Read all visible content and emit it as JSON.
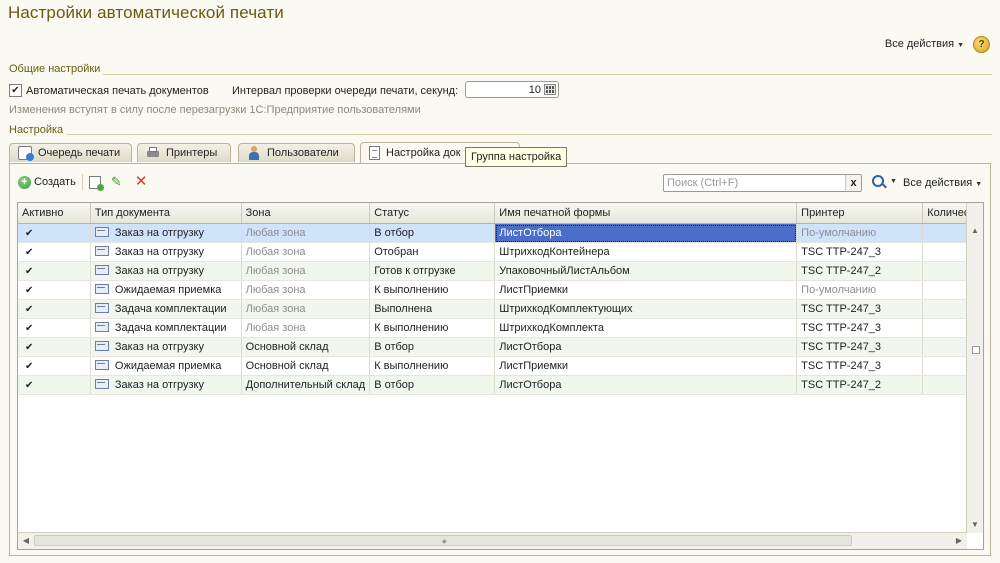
{
  "title": "Настройки автоматической печати",
  "top_actions": {
    "all_actions": "Все действия",
    "help": "?"
  },
  "general": {
    "caption": "Общие настройки",
    "auto_print_label": "Автоматическая печать документов",
    "auto_print_checked": true,
    "interval_label": "Интервал проверки очереди печати, секунд:",
    "interval_value": "10",
    "note": "Изменения вступят в силу после перезагрузки 1С:Предприятие пользователями"
  },
  "settings": {
    "caption": "Настройка",
    "tabs": [
      {
        "label": "Очередь печати",
        "icon": "print-queue-icon"
      },
      {
        "label": "Принтеры",
        "icon": "printer-icon"
      },
      {
        "label": "Пользователи",
        "icon": "user-icon"
      },
      {
        "label": "Настройка док",
        "icon": "document-icon",
        "active": true
      }
    ],
    "tooltip": "Группа настройка"
  },
  "toolbar": {
    "create_label": "Создать",
    "search_placeholder": "Поиск (Ctrl+F)",
    "clear_label": "x",
    "all_actions": "Все действия"
  },
  "table": {
    "columns": [
      "Активно",
      "Тип документа",
      "Зона",
      "Статус",
      "Имя печатной формы",
      "Принтер",
      "Количес"
    ],
    "rows": [
      {
        "active": "✔",
        "doc_type": "Заказ на отгрузку",
        "zone": "Любая зона",
        "status": "В отбор",
        "form": "ЛистОтбора",
        "printer": "По-умолчанию"
      },
      {
        "active": "✔",
        "doc_type": "Заказ на отгрузку",
        "zone": "Любая зона",
        "status": "Отобран",
        "form": "ШтрихкодКонтейнера",
        "printer": "TSC TTP-247_3"
      },
      {
        "active": "✔",
        "doc_type": "Заказ на отгрузку",
        "zone": "Любая зона",
        "status": "Готов к отгрузке",
        "form": "УпаковочныйЛистАльбом",
        "printer": "TSC TTP-247_2"
      },
      {
        "active": "✔",
        "doc_type": "Ожидаемая приемка",
        "zone": "Любая зона",
        "status": "К выполнению",
        "form": "ЛистПриемки",
        "printer": "По-умолчанию"
      },
      {
        "active": "✔",
        "doc_type": "Задача комплектации",
        "zone": "Любая зона",
        "status": "Выполнена",
        "form": "ШтрихкодКомплектующих",
        "printer": "TSC TTP-247_3"
      },
      {
        "active": "✔",
        "doc_type": "Задача комплектации",
        "zone": "Любая зона",
        "status": "К выполнению",
        "form": "ШтрихкодКомплекта",
        "printer": "TSC TTP-247_3"
      },
      {
        "active": "✔",
        "doc_type": "Заказ на отгрузку",
        "zone": "Основной склад",
        "status": "В отбор",
        "form": "ЛистОтбора",
        "printer": "TSC TTP-247_3"
      },
      {
        "active": "✔",
        "doc_type": "Ожидаемая приемка",
        "zone": "Основной склад",
        "status": "К выполнению",
        "form": "ЛистПриемки",
        "printer": "TSC TTP-247_3"
      },
      {
        "active": "✔",
        "doc_type": "Заказ на отгрузку",
        "zone": "Дополнительный склад",
        "status": "В отбор",
        "form": "ЛистОтбора",
        "printer": "TSC TTP-247_2"
      }
    ]
  },
  "colors": {
    "title": "#6b5a13",
    "selection": "#cfe3fb",
    "current_cell": "#4a6fc9",
    "alt_row": "#f1f6ef"
  }
}
